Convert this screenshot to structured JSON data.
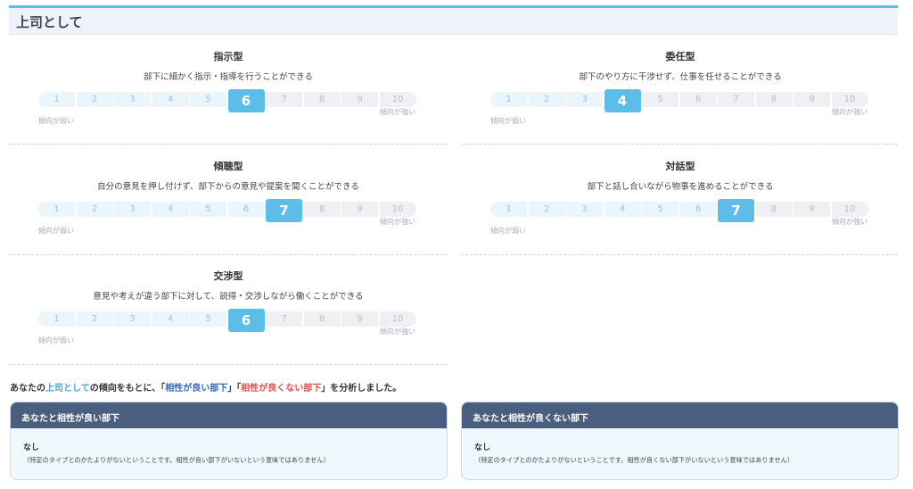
{
  "header": {
    "title": "上司として"
  },
  "scale": {
    "low_label": "傾向が弱い",
    "high_label": "傾向が強い",
    "numbers": [
      "1",
      "2",
      "3",
      "4",
      "5",
      "6",
      "7",
      "8",
      "9",
      "10"
    ]
  },
  "cards": [
    {
      "title": "指示型",
      "description": "部下に細かく指示・指導を行うことができる",
      "value": 6
    },
    {
      "title": "委任型",
      "description": "部下のやり方に干渉せず、仕事を任せることができる",
      "value": 4
    },
    {
      "title": "傾聴型",
      "description": "自分の意見を押し付けず、部下からの意見や提案を聞くことができる",
      "value": 7
    },
    {
      "title": "対話型",
      "description": "部下と話し合いながら物事を進めることができる",
      "value": 7
    },
    {
      "title": "交渉型",
      "description": "意見や考えが違う部下に対して、説得・交渉しながら働くことができる",
      "value": 6
    }
  ],
  "summary": {
    "part1": "あなたの",
    "part2": "上司として",
    "part3": "の傾向をもとに、「",
    "part4": "相性が良い部下",
    "part5": "」「",
    "part6": "相性が良くない部下",
    "part7": "」を分析しました。"
  },
  "boxes": [
    {
      "heading": "あなたと相性が良い部下",
      "result": "なし",
      "note": "（特定のタイプとのかたよりがないということです。相性が良い部下がいないという意味ではありません）"
    },
    {
      "heading": "あなたと相性が良くない部下",
      "result": "なし",
      "note": "（特定のタイプとのかたよりがないということです。相性が良くない部下がいないという意味ではありません）"
    }
  ],
  "colors": {
    "accent": "#5bbde8",
    "box_header": "#4a5e80",
    "good": "#2e68c2",
    "bad": "#e05050"
  }
}
